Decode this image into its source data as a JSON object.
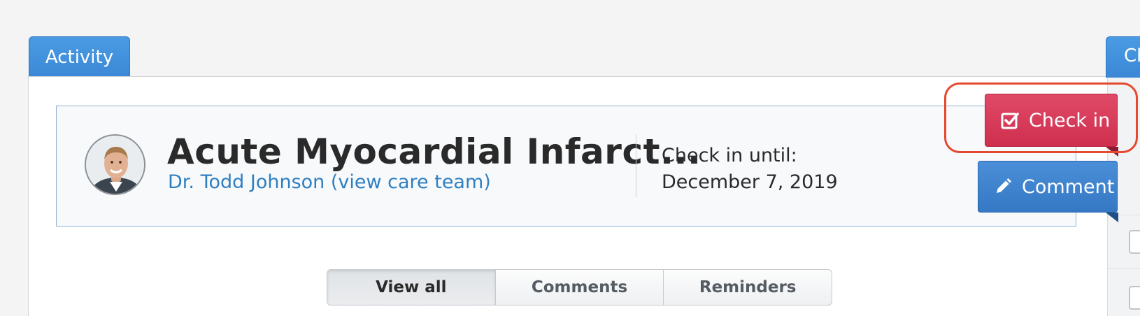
{
  "tabs": {
    "activity_label": "Activity",
    "right_tab_label": "Ch"
  },
  "condition": {
    "title": "Acute Myocardial Infarct...",
    "care_team_link": "Dr. Todd Johnson (view care team)",
    "checkin_until_label": "Check in until:",
    "checkin_until_date": "December 7, 2019"
  },
  "actions": {
    "checkin_label": "Check in",
    "comment_label": "Comment"
  },
  "filter": {
    "options": [
      "View all",
      "Comments",
      "Reminders"
    ],
    "selected": "View all"
  },
  "icons": {
    "checkin": "checkbox-check-icon",
    "comment": "pencil-icon"
  },
  "colors": {
    "primary_blue": "#3b88d6",
    "checkin_red": "#cf2f4f",
    "link_blue": "#2f7fc1",
    "highlight": "#e5492f"
  }
}
